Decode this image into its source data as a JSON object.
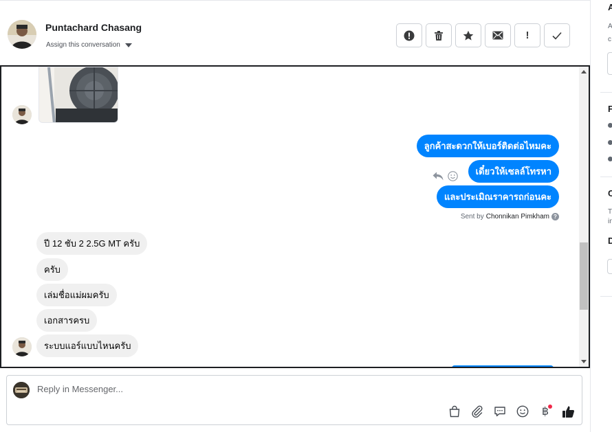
{
  "header": {
    "contact_name": "Puntachard Chasang",
    "assign_label": "Assign this conversation",
    "actions": [
      {
        "name": "mark-spam-button",
        "icon": "alert-circle-icon"
      },
      {
        "name": "delete-button",
        "icon": "trash-icon"
      },
      {
        "name": "star-button",
        "icon": "star-icon"
      },
      {
        "name": "mark-unread-button",
        "icon": "envelope-icon"
      },
      {
        "name": "follow-up-button",
        "icon": "exclamation-icon",
        "glyph": "!"
      },
      {
        "name": "mark-done-button",
        "icon": "checkmark-icon"
      }
    ]
  },
  "messages": {
    "outgoing": [
      "ลูกค้าสะดวกให้เบอร์ติดต่อไหมคะ",
      "เดี๋ยวให้เซลล์โทรหา",
      "และประเมิณราคารถก่อนคะ"
    ],
    "sent_by_prefix": "Sent by",
    "sent_by_name": "Chonnikan Pimkham",
    "help_glyph": "?",
    "incoming": [
      "ปี 12 ชับ 2 2.5G MT ครับ",
      "ครับ",
      "เล่มชื่อแม่ผมครับ",
      "เอกสารครบ",
      "ระบบแอร์แบบไหนครับ"
    ]
  },
  "composer": {
    "placeholder": "Reply in Messenger...",
    "tools": [
      "shopping-bag-icon",
      "paperclip-icon",
      "saved-reply-icon",
      "emoji-icon",
      "baht-payment-icon",
      "thumbs-up-icon"
    ],
    "baht_glyph": "฿"
  },
  "right_panel": {
    "section_initials": [
      "A",
      "F",
      "C",
      "D"
    ],
    "small_text": [
      "A",
      "c",
      "T",
      "in"
    ]
  },
  "colors": {
    "accent": "#0084ff",
    "incoming_bubble": "#f0f0f0",
    "badge": "#f02849"
  }
}
